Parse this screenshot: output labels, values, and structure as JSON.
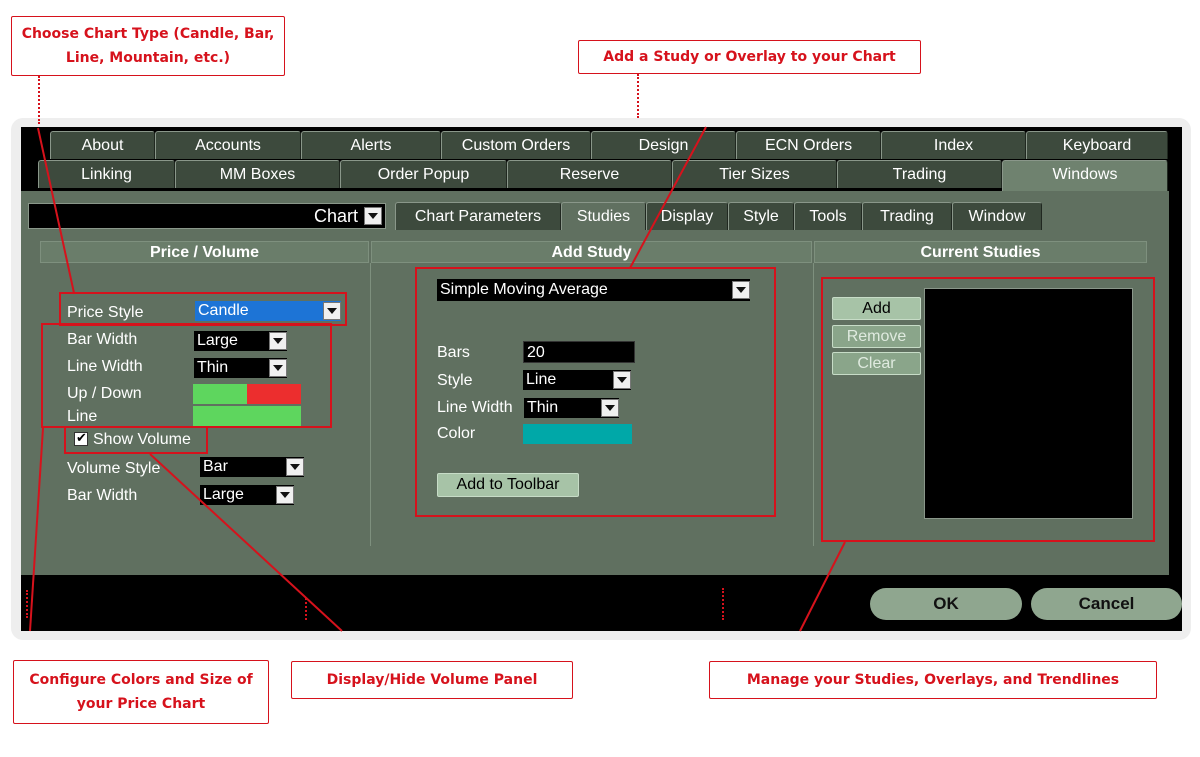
{
  "callouts": {
    "chart_type": "Choose Chart Type (Candle, Bar, Line, Mountain, etc.)",
    "add_study": "Add a Study or Overlay to your Chart",
    "configure_colors": "Configure Colors and Size of your Price Chart",
    "volume_panel": "Display/Hide Volume Panel",
    "manage_studies": "Manage your Studies, Overlays, and Trendlines"
  },
  "tabs_row1": [
    "About",
    "Accounts",
    "Alerts",
    "Custom Orders",
    "Design",
    "ECN Orders",
    "Index",
    "Keyboard"
  ],
  "tabs_row2": [
    "Linking",
    "MM Boxes",
    "Order Popup",
    "Reserve",
    "Tier Sizes",
    "Trading",
    "Windows"
  ],
  "active_tab": "Windows",
  "window_select": {
    "value": "Chart"
  },
  "subtabs": [
    "Chart Parameters",
    "Studies",
    "Display",
    "Style",
    "Tools",
    "Trading",
    "Window"
  ],
  "active_subtab": "Studies",
  "price_volume": {
    "heading": "Price / Volume",
    "price_style_label": "Price Style",
    "price_style_value": "Candle",
    "bar_width_label": "Bar Width",
    "bar_width_value": "Large",
    "line_width_label": "Line Width",
    "line_width_value": "Thin",
    "up_down_label": "Up / Down",
    "line_label": "Line",
    "show_volume_label": "Show Volume",
    "show_volume_checked": true,
    "volume_style_label": "Volume Style",
    "volume_style_value": "Bar",
    "vol_bar_width_label": "Bar Width",
    "vol_bar_width_value": "Large",
    "up_color": "#5ed65e",
    "down_color": "#ec2e2e",
    "line_color": "#5ed65e"
  },
  "add_study": {
    "heading": "Add Study",
    "study_select": "Simple Moving Average",
    "bars_label": "Bars",
    "bars_value": "20",
    "style_label": "Style",
    "style_value": "Line",
    "line_width_label": "Line Width",
    "line_width_value": "Thin",
    "color_label": "Color",
    "color_value": "#00a8a8",
    "add_to_toolbar": "Add to Toolbar"
  },
  "current_studies": {
    "heading": "Current Studies",
    "add": "Add",
    "remove": "Remove",
    "clear": "Clear"
  },
  "buttons": {
    "ok": "OK",
    "cancel": "Cancel"
  }
}
